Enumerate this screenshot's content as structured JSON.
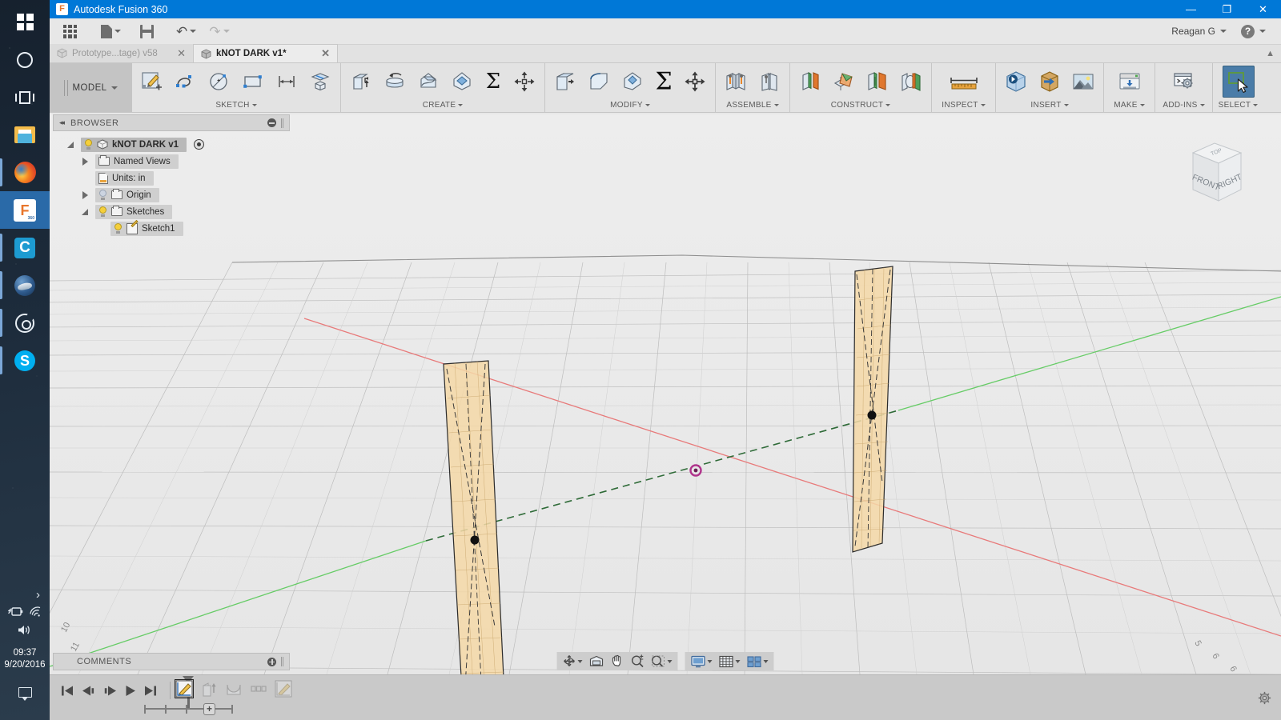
{
  "taskbar": {
    "items": [
      {
        "name": "start-button",
        "icon": "windows-logo-icon",
        "label": "Start"
      },
      {
        "name": "cortana-button",
        "icon": "cortana-circle-icon",
        "label": "Cortana"
      },
      {
        "name": "task-view-button",
        "icon": "task-view-icon",
        "label": "Task View"
      },
      {
        "name": "file-explorer-button",
        "icon": "folder-icon",
        "label": "File Explorer"
      },
      {
        "name": "firefox-button",
        "icon": "firefox-icon",
        "label": "Mozilla Firefox"
      },
      {
        "name": "fusion360-button",
        "icon": "fusion-f-icon",
        "label": "Autodesk Fusion 360"
      },
      {
        "name": "app-c-button",
        "icon": "letter-c-icon",
        "label": "C"
      },
      {
        "name": "thunderbird-button",
        "icon": "thunderbird-icon",
        "label": "Thunderbird"
      },
      {
        "name": "orbit-app-button",
        "icon": "orbit-circle-icon",
        "label": "Orbit"
      },
      {
        "name": "skype-button",
        "icon": "skype-icon",
        "label": "Skype"
      }
    ],
    "tray": {
      "chevron": "›",
      "battery_icon": "battery-charging-icon",
      "wifi_icon": "wifi-icon",
      "volume_icon": "speaker-icon",
      "time": "09:37",
      "date": "9/20/2016",
      "action_center_icon": "notification-icon"
    }
  },
  "titlebar": {
    "icon": "fusion-app-icon",
    "title": "Autodesk Fusion 360",
    "minimize": "—",
    "restore": "❐",
    "close": "✕"
  },
  "quick_access": {
    "grid_label": "app-grid",
    "new_label": "new-document",
    "save_label": "save",
    "undo_label": "undo",
    "redo_label": "redo",
    "account_name": "Reagan G",
    "help_label": "?"
  },
  "doc_tabs": [
    {
      "label": "Prototype...tage) v58",
      "active": false,
      "close": "✕"
    },
    {
      "label": "kNOT DARK v1*",
      "active": true,
      "close": "✕"
    }
  ],
  "ribbon": {
    "workspace": "MODEL",
    "panels": [
      {
        "label": "SKETCH",
        "has_caret": true,
        "commands": [
          {
            "name": "create-sketch-icon",
            "title": "Create Sketch"
          },
          {
            "name": "spline-icon",
            "title": "Spline"
          },
          {
            "name": "circle-icon",
            "title": "Circle"
          },
          {
            "name": "rectangle-icon",
            "title": "Rectangle"
          },
          {
            "name": "sketch-dimension-icon",
            "title": "Sketch Dimension"
          },
          {
            "name": "project-icon",
            "title": "Project / Include"
          }
        ]
      },
      {
        "label": "CREATE",
        "has_caret": true,
        "commands": [
          {
            "name": "extrude-icon",
            "title": "Extrude"
          },
          {
            "name": "revolve-icon",
            "title": "Revolve"
          },
          {
            "name": "sweep-icon",
            "title": "Sweep"
          },
          {
            "name": "loft-icon",
            "title": "Loft"
          },
          {
            "name": "rib-icon",
            "title": "Rib"
          },
          {
            "name": "box-primitive-icon",
            "title": "Box"
          }
        ]
      },
      {
        "label": "MODIFY",
        "has_caret": true,
        "commands": [
          {
            "name": "press-pull-icon",
            "title": "Press Pull"
          },
          {
            "name": "fillet-icon",
            "title": "Fillet"
          },
          {
            "name": "chamfer-icon",
            "title": "Chamfer"
          },
          {
            "name": "combine-sigma-icon",
            "title": "Combine"
          },
          {
            "name": "move-copy-icon",
            "title": "Move / Copy"
          }
        ]
      },
      {
        "label": "ASSEMBLE",
        "has_caret": true,
        "commands": [
          {
            "name": "joint-icon",
            "title": "Joint"
          },
          {
            "name": "as-built-joint-icon",
            "title": "As-built Joint"
          }
        ]
      },
      {
        "label": "CONSTRUCT",
        "has_caret": true,
        "commands": [
          {
            "name": "offset-plane-icon",
            "title": "Offset Plane"
          },
          {
            "name": "plane-at-angle-icon",
            "title": "Plane at Angle"
          },
          {
            "name": "tangent-plane-icon",
            "title": "Tangent Plane"
          },
          {
            "name": "midplane-icon",
            "title": "Midplane"
          }
        ]
      },
      {
        "label": "INSPECT",
        "has_caret": true,
        "commands": [
          {
            "name": "measure-icon",
            "title": "Measure"
          }
        ]
      },
      {
        "label": "INSERT",
        "has_caret": true,
        "commands": [
          {
            "name": "insert-derive-icon",
            "title": "Insert Derive"
          },
          {
            "name": "insert-mcmaster-icon",
            "title": "Insert McMaster-Carr Component"
          },
          {
            "name": "canvas-image-icon",
            "title": "Attached Canvas"
          }
        ]
      },
      {
        "label": "MAKE",
        "has_caret": true,
        "commands": [
          {
            "name": "3d-print-icon",
            "title": "3D Print"
          }
        ]
      },
      {
        "label": "ADD-INS",
        "has_caret": true,
        "commands": [
          {
            "name": "scripts-addins-icon",
            "title": "Scripts and Add-Ins"
          }
        ]
      },
      {
        "label": "SELECT",
        "has_caret": true,
        "selected": true,
        "commands": [
          {
            "name": "select-tool-icon",
            "title": "Select"
          }
        ]
      }
    ]
  },
  "browser": {
    "title": "BROWSER",
    "collapse_icon": "◂◂",
    "minimize_icon": "minus-circle-icon",
    "tree": [
      {
        "label": "kNOT DARK v1",
        "depth": 0,
        "expander": "open",
        "bulb": "on",
        "icon": "component-cube-icon",
        "root": true,
        "radio": true
      },
      {
        "label": "Named Views",
        "depth": 1,
        "expander": "closed",
        "bulb": "none",
        "icon": "folder-icon"
      },
      {
        "label": "Units: in",
        "depth": 1,
        "expander": "none",
        "bulb": "none",
        "icon": "units-document-icon"
      },
      {
        "label": "Origin",
        "depth": 1,
        "expander": "closed",
        "bulb": "off",
        "icon": "folder-icon"
      },
      {
        "label": "Sketches",
        "depth": 1,
        "expander": "open",
        "bulb": "on",
        "icon": "folder-icon"
      },
      {
        "label": "Sketch1",
        "depth": 2,
        "expander": "none",
        "bulb": "on",
        "icon": "sketch-icon"
      }
    ]
  },
  "viewcube": {
    "faces": {
      "top": "TOP",
      "front": "FRONT",
      "right": "RIGHT"
    }
  },
  "comments": {
    "title": "COMMENTS",
    "add_icon": "plus-circle-icon"
  },
  "navbar": {
    "group1": [
      {
        "name": "orbit-button",
        "icon": "orbit-icon",
        "caret": true
      },
      {
        "name": "look-at-button",
        "icon": "look-at-icon",
        "caret": false
      },
      {
        "name": "pan-button",
        "icon": "pan-hand-icon",
        "caret": false
      },
      {
        "name": "zoom-button",
        "icon": "zoom-magnifier-icon",
        "caret": false
      },
      {
        "name": "fit-button",
        "icon": "zoom-fit-icon",
        "caret": true
      }
    ],
    "group2": [
      {
        "name": "display-settings-button",
        "icon": "display-monitor-icon",
        "caret": true
      },
      {
        "name": "grid-snaps-button",
        "icon": "grid-icon",
        "caret": true
      },
      {
        "name": "viewports-button",
        "icon": "viewports-icon",
        "caret": true
      }
    ]
  },
  "timeline": {
    "playback": [
      {
        "name": "go-to-beginning-button",
        "icon": "skip-start-icon"
      },
      {
        "name": "step-back-button",
        "icon": "step-back-icon"
      },
      {
        "name": "step-forward-button",
        "icon": "step-forward-icon"
      },
      {
        "name": "play-button",
        "icon": "play-icon"
      },
      {
        "name": "go-to-end-button",
        "icon": "skip-end-icon"
      }
    ],
    "features": [
      {
        "name": "timeline-feature-sketch1",
        "icon": "sketch-feature-icon",
        "state": "current"
      },
      {
        "name": "timeline-feature-extrude",
        "icon": "extrude-feature-icon",
        "state": "ghost"
      },
      {
        "name": "timeline-feature-revolve",
        "icon": "revolve-feature-icon",
        "state": "ghost"
      },
      {
        "name": "timeline-feature-dots",
        "icon": "dots-feature-icon",
        "state": "ghost"
      },
      {
        "name": "timeline-feature-sketch2",
        "icon": "sketch-feature-icon",
        "state": "ghost"
      }
    ],
    "end_marker_label": "+",
    "settings_icon": "gear-icon"
  },
  "scene": {
    "axes": {
      "x_color": "#e86a6a",
      "y_color": "#5fc95f",
      "z_color": "#8a8a8a"
    },
    "grid_color": "#b6b6b6",
    "sketch_fill": "#f2d9ac",
    "sketch_edge": "#2b2b2b",
    "origin_point_color": "#b0348c",
    "point_color": "#111111",
    "background": "#ebebeb",
    "ruler_labels": [
      "10",
      "11",
      "5",
      "6"
    ]
  }
}
